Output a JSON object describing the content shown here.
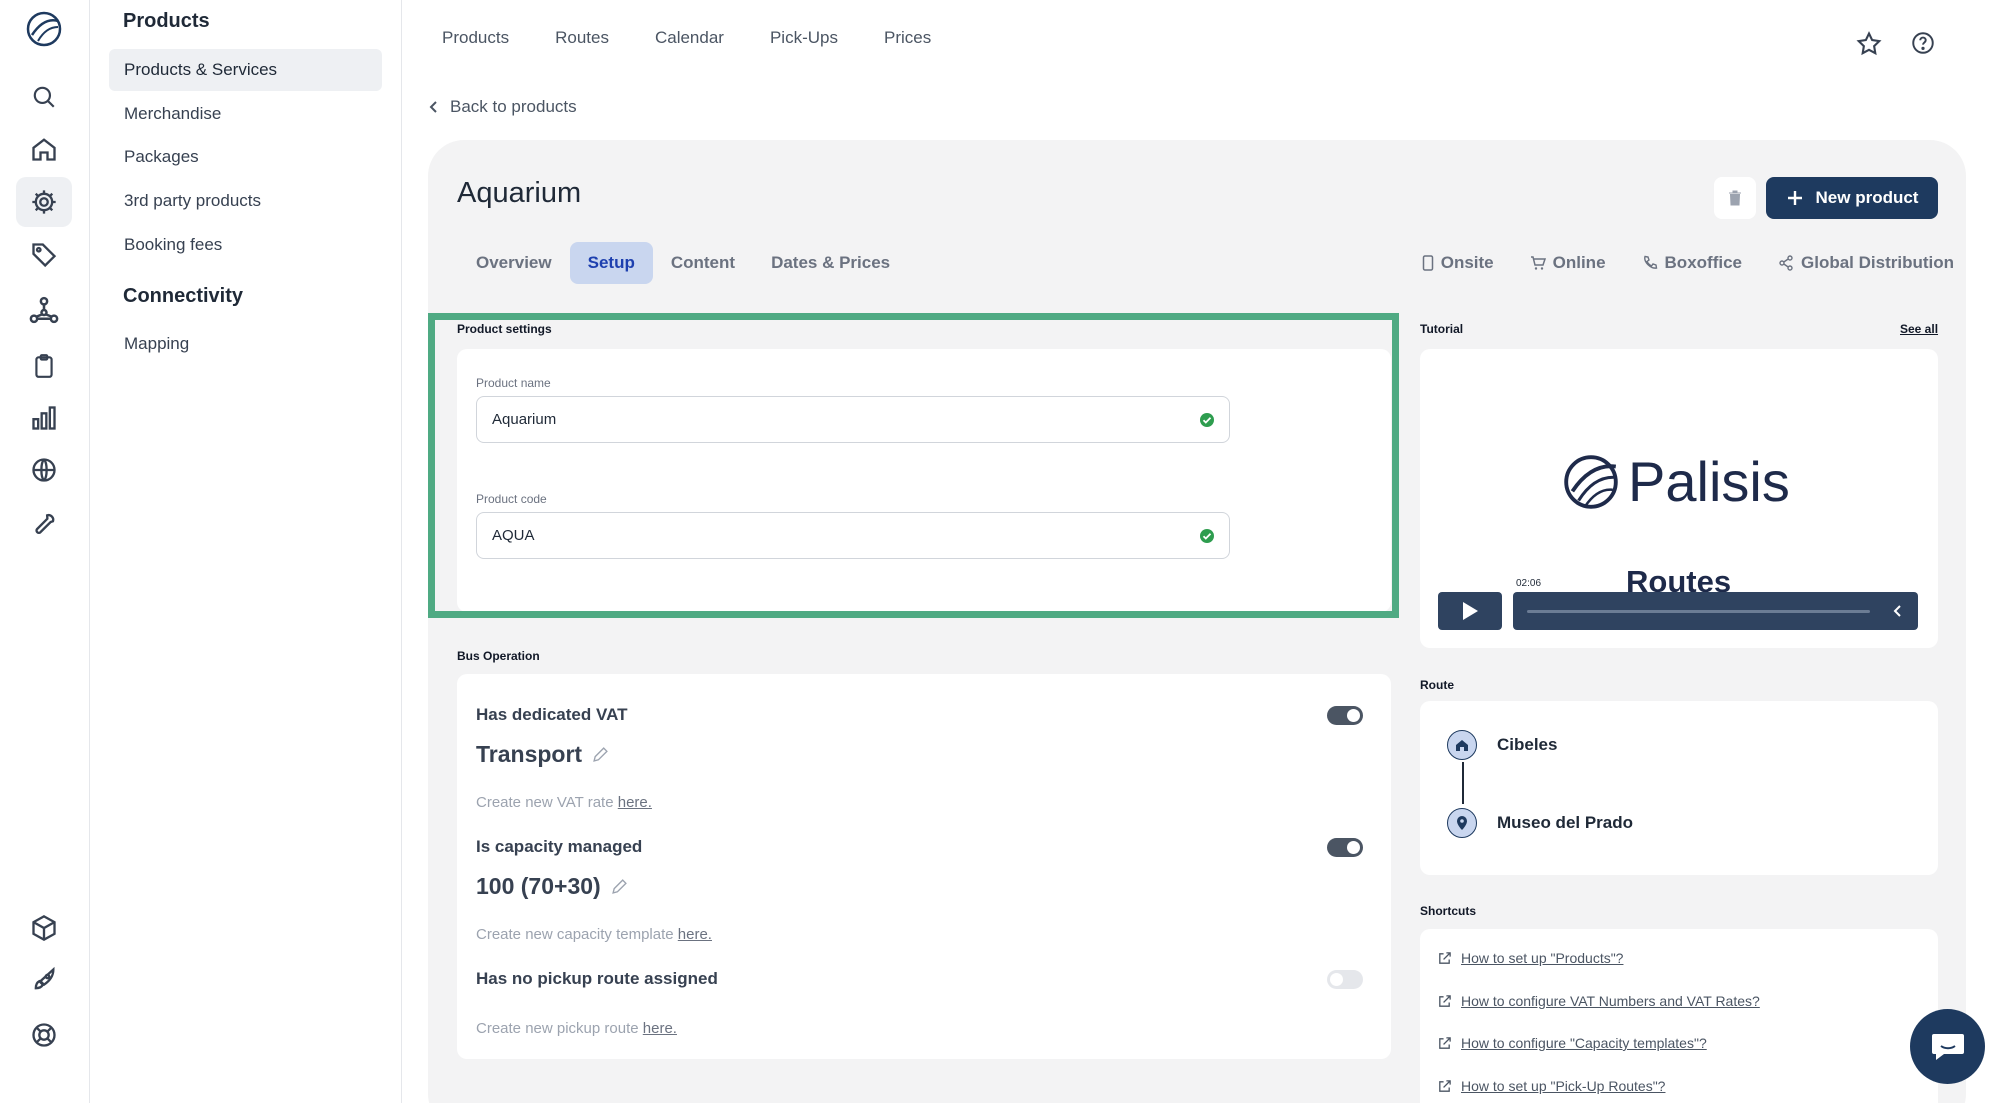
{
  "rail": [
    "logo-icon",
    "search-icon",
    "home-icon",
    "gear-icon",
    "tag-icon",
    "network-icon",
    "clipboard-icon",
    "bar-chart-icon",
    "globe-icon",
    "wrench-icon",
    "cube-icon",
    "rocket-icon",
    "lifebuoy-icon"
  ],
  "sidebar": {
    "products_heading": "Products",
    "products_items": [
      "Products & Services",
      "Merchandise",
      "Packages",
      "3rd party products",
      "Booking fees"
    ],
    "connectivity_heading": "Connectivity",
    "connectivity_items": [
      "Mapping"
    ]
  },
  "topnav": [
    "Products",
    "Routes",
    "Calendar",
    "Pick-Ups",
    "Prices"
  ],
  "back_label": "Back to products",
  "product": {
    "title": "Aquarium",
    "new_button": "New product",
    "tabs": [
      "Overview",
      "Setup",
      "Content",
      "Dates & Prices"
    ],
    "active_tab": "Setup",
    "channels": [
      "Onsite",
      "Online",
      "Boxoffice",
      "Global Distribution"
    ]
  },
  "settings": {
    "heading": "Product settings",
    "name_label": "Product name",
    "name_value": "Aquarium",
    "code_label": "Product code",
    "code_value": "AQUA"
  },
  "bus": {
    "heading": "Bus Operation",
    "vat_label": "Has dedicated VAT",
    "vat_value": "Transport",
    "vat_help": "Create new VAT rate",
    "capacity_label": "Is capacity managed",
    "capacity_value": "100 (70+30)",
    "capacity_help": "Create new capacity template",
    "pickup_label": "Has no pickup route assigned",
    "pickup_help": "Create new pickup route",
    "here": "here."
  },
  "tutorial": {
    "heading": "Tutorial",
    "see_all": "See all",
    "brand": "Palisis",
    "video_title": "Routes",
    "time": "02:06"
  },
  "route": {
    "heading": "Route",
    "from": "Cibeles",
    "to": "Museo del Prado"
  },
  "shortcuts": {
    "heading": "Shortcuts",
    "links": [
      "How to set up \"Products\"?",
      "How to configure VAT Numbers and VAT Rates?",
      "How to configure \"Capacity templates\"?",
      "How to set up \"Pick-Up Routes\"?"
    ]
  },
  "colors": {
    "accent": "#1e3a5f",
    "highlight": "#4faa83",
    "tab_active": "#c9d6ef",
    "panel": "#f3f3f4"
  }
}
